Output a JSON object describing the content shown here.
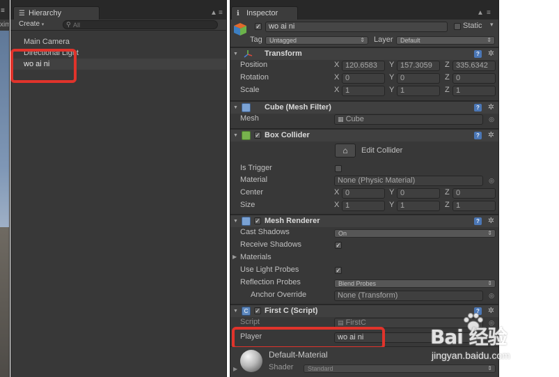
{
  "scene": {
    "edge_label": "xim",
    "edge_ctrl": "≡"
  },
  "hierarchy": {
    "tab_label": "Hierarchy",
    "create_label": "Create",
    "search_placeholder": "All",
    "items": [
      {
        "label": "Main Camera"
      },
      {
        "label": "Directional Light"
      },
      {
        "label": "wo ai ni"
      }
    ]
  },
  "inspector": {
    "tab_label": "Inspector",
    "object": {
      "name": "wo ai ni",
      "static_label": "Static",
      "tag_label": "Tag",
      "tag_value": "Untagged",
      "layer_label": "Layer",
      "layer_value": "Default"
    },
    "transform": {
      "title": "Transform",
      "position": {
        "label": "Position",
        "x": "120.6583",
        "y": "157.3059",
        "z": "335.6342"
      },
      "rotation": {
        "label": "Rotation",
        "x": "0",
        "y": "0",
        "z": "0"
      },
      "scale": {
        "label": "Scale",
        "x": "1",
        "y": "1",
        "z": "1"
      }
    },
    "mesh_filter": {
      "title": "Cube (Mesh Filter)",
      "mesh_label": "Mesh",
      "mesh_value": "Cube"
    },
    "box_collider": {
      "title": "Box Collider",
      "edit_label": "Edit Collider",
      "is_trigger_label": "Is Trigger",
      "material_label": "Material",
      "material_value": "None (Physic Material)",
      "center": {
        "label": "Center",
        "x": "0",
        "y": "0",
        "z": "0"
      },
      "size": {
        "label": "Size",
        "x": "1",
        "y": "1",
        "z": "1"
      }
    },
    "mesh_renderer": {
      "title": "Mesh Renderer",
      "cast_shadows_label": "Cast Shadows",
      "cast_shadows_value": "On",
      "receive_shadows_label": "Receive Shadows",
      "materials_label": "Materials",
      "light_probes_label": "Use Light Probes",
      "reflection_label": "Reflection Probes",
      "reflection_value": "Blend Probes",
      "anchor_label": "Anchor Override",
      "anchor_value": "None (Transform)"
    },
    "script": {
      "title": "First C (Script)",
      "script_label": "Script",
      "script_value": "FirstC",
      "player_label": "Player",
      "player_value": "wo ai ni"
    },
    "material": {
      "name": "Default-Material",
      "shader_label": "Shader",
      "shader_value": "Standard"
    }
  },
  "watermark": {
    "brand": "Bai 经验",
    "url": "jingyan.baidu.com"
  },
  "colors": {
    "highlight": "#e0332b",
    "panel": "#383838",
    "help_blue": "#4b77b6"
  }
}
